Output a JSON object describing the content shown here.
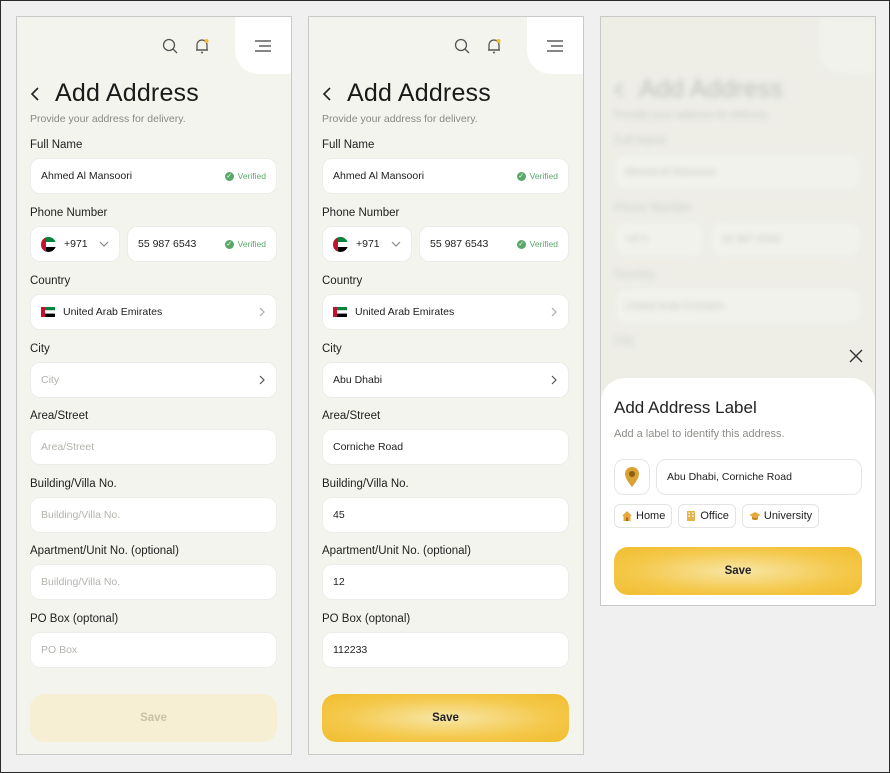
{
  "common": {
    "title": "Add Address",
    "subtitle": "Provide your address for delivery.",
    "labels": {
      "full_name": "Full Name",
      "phone": "Phone Number",
      "country": "Country",
      "city": "City",
      "area": "Area/Street",
      "building": "Building/Villa No.",
      "apartment": "Apartment/Unit No. (optional)",
      "pobox": "PO Box (optonal)"
    },
    "verified": "Verified",
    "save": "Save",
    "icons": {
      "search": "search-icon",
      "bell": "bell-icon",
      "menu": "menu-icon",
      "back": "back-chevron-icon"
    },
    "colors": {
      "accent": "#F4C84A",
      "verified": "#5AA869",
      "background": "#F4F4EF"
    }
  },
  "screen1": {
    "full_name": "Ahmed Al Mansoori",
    "phone_code": "+971",
    "phone_number": "55 987 6543",
    "country": "United Arab Emirates",
    "city_placeholder": "City",
    "area_placeholder": "Area/Street",
    "building_placeholder": "Building/Villa No.",
    "apartment_placeholder": "Building/Villa No.",
    "pobox_placeholder": "PO Box"
  },
  "screen2": {
    "full_name": "Ahmed Al Mansoori",
    "phone_code": "+971",
    "phone_number": "55 987 6543",
    "country": "United Arab Emirates",
    "city": "Abu Dhabi",
    "area": "Corniche Road",
    "building": "45",
    "apartment": "12",
    "pobox": "112233"
  },
  "screen3": {
    "sheet_title": "Add Address Label",
    "sheet_subtitle": "Add a label to identify this address.",
    "address": "Abu Dhabi, Corniche Road",
    "chips": [
      {
        "label": "Home",
        "icon": "house-icon"
      },
      {
        "label": "Office",
        "icon": "building-icon"
      },
      {
        "label": "University",
        "icon": "graduation-cap-icon"
      }
    ],
    "save": "Save"
  }
}
